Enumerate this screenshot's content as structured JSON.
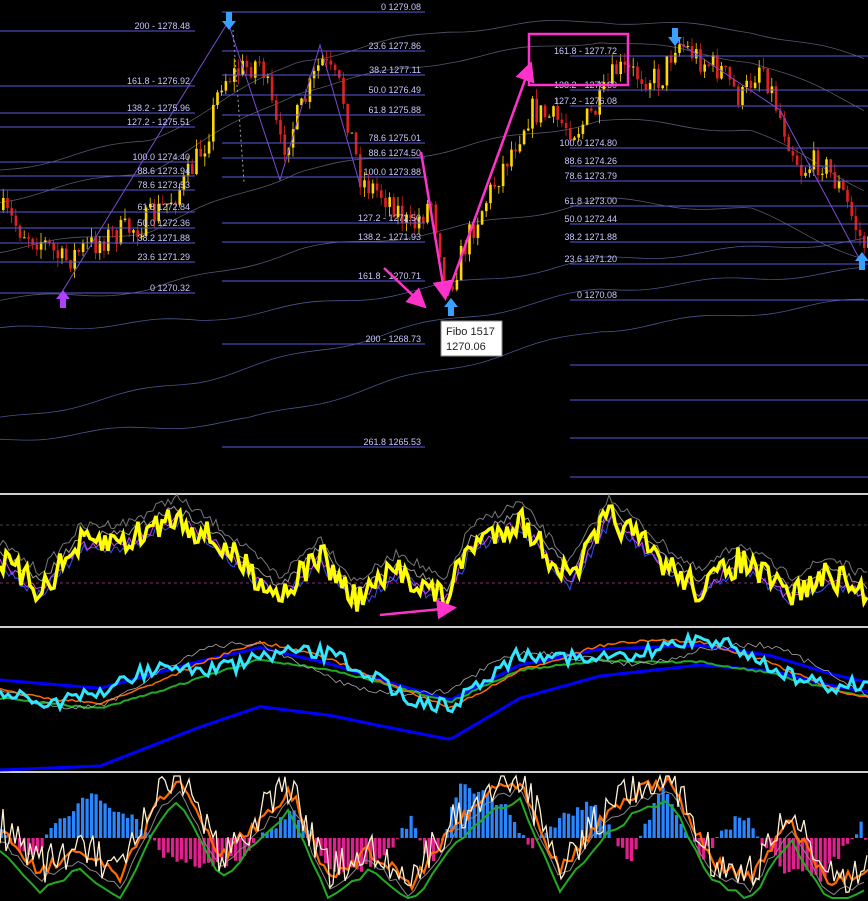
{
  "colors": {
    "background": "#000000",
    "fibo_line": "#5a5adc",
    "fibo_text": "#c8c8ff",
    "candle_bull": "#ffd800",
    "candle_bear": "#e02020",
    "magenta": "#ff33cc",
    "arrow_blue": "#3aa0ff",
    "arrow_purple": "#b040ff",
    "osc_yellow": "#ffff00",
    "ma_cyan": "#33e6ff",
    "ma_blue": "#0000ff",
    "ma_orange": "#ff6a00",
    "ma_green": "#22aa22",
    "hist_blue": "#2a86ff",
    "hist_magenta": "#e0208c",
    "stoch_white": "#fff0d0"
  },
  "tooltip": {
    "title": "Fibo 1517",
    "value": "1270.06"
  },
  "chart_data": [
    {
      "type": "candlestick",
      "name": "price",
      "fibo_sets": [
        {
          "levels": [
            {
              "label": "200 - 1278.48"
            },
            {
              "label": "161.8 - 1276.92"
            },
            {
              "label": "138.2 - 1275.96"
            },
            {
              "label": "127.2 - 1275.51"
            },
            {
              "label": "100.0 1274.40"
            },
            {
              "label": "88.6 1273.94"
            },
            {
              "label": "78.6 1273.53"
            },
            {
              "label": "61.8 1272.84"
            },
            {
              "label": "50.0 1272.36"
            },
            {
              "label": "38.2 1271.88"
            },
            {
              "label": "23.6 1271.29"
            },
            {
              "label": "0 1270.32"
            }
          ]
        },
        {
          "levels": [
            {
              "label": "0 1279.08"
            },
            {
              "label": "23.6 1277.86"
            },
            {
              "label": "38.2 1277.11"
            },
            {
              "label": "50.0 1276.49"
            },
            {
              "label": "61.8 1275.88"
            },
            {
              "label": "78.6 1275.01"
            },
            {
              "label": "88.6 1274.50"
            },
            {
              "label": "100.0 1273.88"
            },
            {
              "label": "127.2 - 1272.50"
            },
            {
              "label": "138.2 - 1271.93"
            },
            {
              "label": "161.8 - 1270.71"
            },
            {
              "label": "200 - 1268.73"
            },
            {
              "label": "261.8 1265.53"
            }
          ]
        },
        {
          "levels": [
            {
              "label": "161.8 - 1277.72"
            },
            {
              "label": "138.2 - 1276.60"
            },
            {
              "label": "127.2 - 1276.08"
            },
            {
              "label": "100.0 1274.80"
            },
            {
              "label": "88.6 1274.26"
            },
            {
              "label": "78.6 1273.79"
            },
            {
              "label": "61.8 1273.00"
            },
            {
              "label": "50.0 1272.44"
            },
            {
              "label": "38.2 1271.88"
            },
            {
              "label": "23.6 1271.20"
            },
            {
              "label": "0 1270.08"
            }
          ]
        }
      ]
    },
    {
      "type": "line",
      "name": "oscillator"
    },
    {
      "type": "line",
      "name": "moving-averages"
    },
    {
      "type": "bar",
      "name": "histogram-stochastic"
    }
  ]
}
